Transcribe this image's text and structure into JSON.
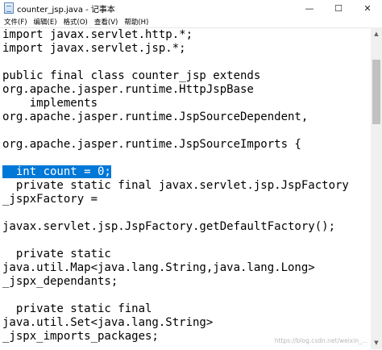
{
  "window": {
    "title": "counter_jsp.java - 记事本",
    "icon": "notepad-icon",
    "controls": {
      "minimize": "—",
      "maximize": "☐",
      "close": "✕"
    }
  },
  "menu": {
    "items": [
      "文件(F)",
      "编辑(E)",
      "格式(O)",
      "查看(V)",
      "帮助(H)"
    ]
  },
  "editor": {
    "selection_color": "#0078d7",
    "lines": [
      "import javax.servlet.http.*;",
      "import javax.servlet.jsp.*;",
      "",
      "public final class counter_jsp extends",
      "org.apache.jasper.runtime.HttpJspBase",
      "    implements",
      "org.apache.jasper.runtime.JspSourceDependent,",
      "",
      "org.apache.jasper.runtime.JspSourceImports {",
      "",
      "  int count = 0;",
      "  private static final javax.servlet.jsp.JspFactory",
      "_jspxFactory =",
      "",
      "javax.servlet.jsp.JspFactory.getDefaultFactory();",
      "",
      "  private static",
      "java.util.Map<java.lang.String,java.lang.Long>",
      "_jspx_dependants;",
      "",
      "  private static final",
      "java.util.Set<java.lang.String>",
      "_jspx_imports_packages;"
    ]
  },
  "scrollbar": {
    "up_arrow": "▲",
    "down_arrow": "▼"
  },
  "watermark": "https://blog.csdn.net/weixin_..."
}
